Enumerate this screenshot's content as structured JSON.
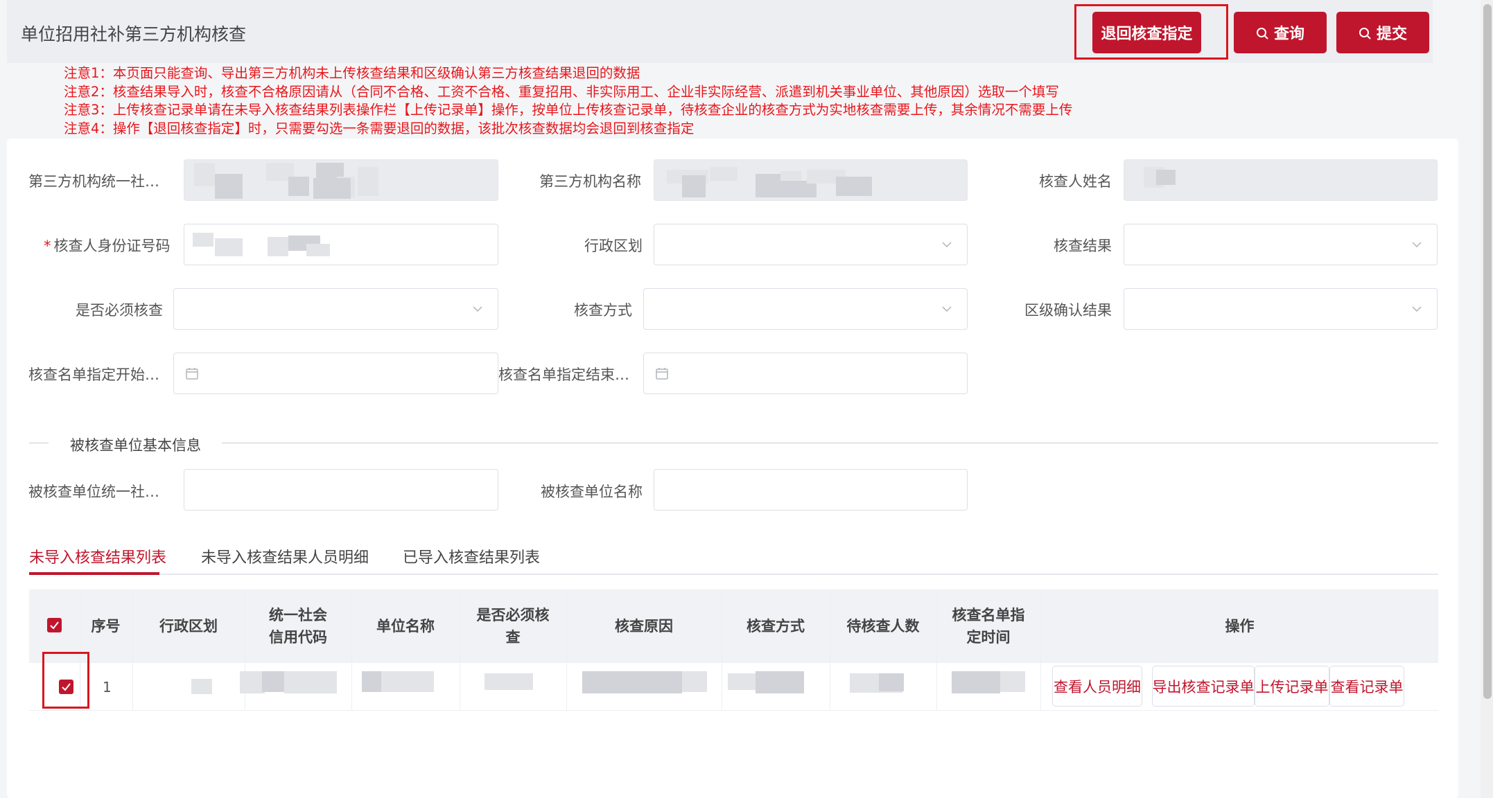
{
  "header": {
    "title": "单位招用社补第三方机构核查",
    "buttons": {
      "return_label": "退回核查指定",
      "query_label": "查询",
      "submit_label": "提交"
    }
  },
  "notes": [
    "注意1：本页面只能查询、导出第三方机构未上传核查结果和区级确认第三方核查结果退回的数据",
    "注意2：核查结果导入时，核查不合格原因请从（合同不合格、工资不合格、重复招用、非实际用工、企业非实际经营、派遣到机关事业单位、其他原因）选取一个填写",
    "注意3：上传核查记录单请在未导入核查结果列表操作栏【上传记录单】操作，按单位上传核查记录单，待核查企业的核查方式为实地核查需要上传，其余情况不需要上传",
    "注意4：操作【退回核查指定】时，只需要勾选一条需要退回的数据，该批次核查数据均会退回到核查指定"
  ],
  "form": {
    "org_code_label": "第三方机构统一社…",
    "org_name_label": "第三方机构名称",
    "inspector_name_label": "核查人姓名",
    "required_mark": "*",
    "inspector_id_label": "核查人身份证号码",
    "district_label": "行政区划",
    "result_label": "核查结果",
    "must_check_label": "是否必须核查",
    "method_label": "核查方式",
    "district_confirm_label": "区级确认结果",
    "start_date_label": "核查名单指定开始…",
    "end_date_label": "核查名单指定结束…"
  },
  "section": {
    "title": "被核查单位基本信息",
    "unit_code_label": "被核查单位统一社…",
    "unit_name_label": "被核查单位名称"
  },
  "tabs": [
    {
      "label": "未导入核查结果列表",
      "active": true
    },
    {
      "label": "未导入核查结果人员明细",
      "active": false
    },
    {
      "label": "已导入核查结果列表",
      "active": false
    }
  ],
  "table": {
    "headers": {
      "index": "序号",
      "district": "行政区划",
      "credit_code": "统一社会信用代码",
      "unit_name": "单位名称",
      "must_check": "是否必须核查",
      "reason": "核查原因",
      "method": "核查方式",
      "pending": "待核查人数",
      "assigned_time": "核查名单指定时间",
      "actions": "操作"
    },
    "rows": [
      {
        "index": "1",
        "checked": true,
        "actions": [
          "查看人员明细",
          "导出核查记录单",
          "上传记录单",
          "查看记录单"
        ]
      }
    ]
  },
  "colors": {
    "accent": "#c0162d",
    "notice": "#e6171c",
    "highlight": "#d9161d"
  },
  "icons": [
    "search-icon",
    "chevron-down-icon",
    "calendar-icon",
    "checkmark-icon"
  ]
}
